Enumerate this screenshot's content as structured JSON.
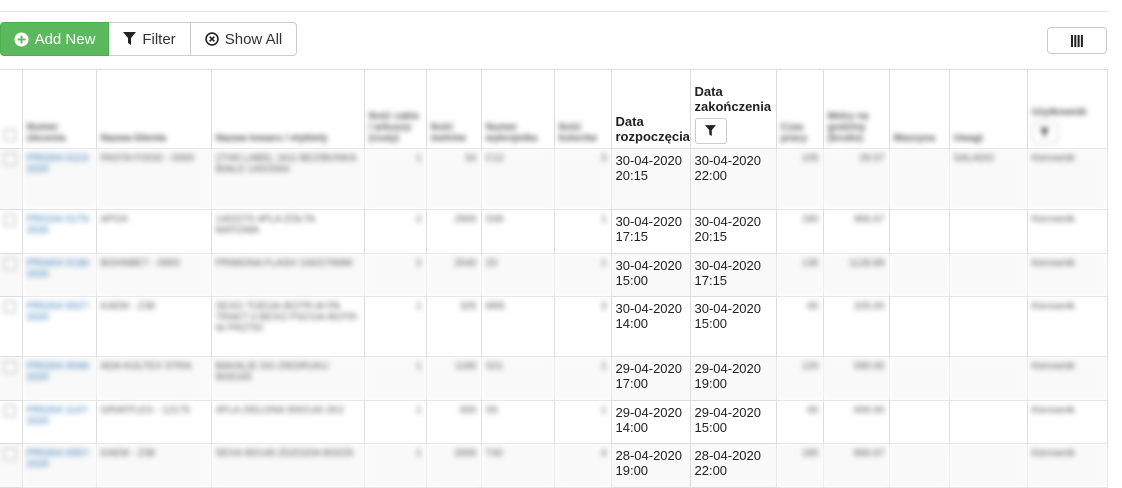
{
  "toolbar": {
    "add_label": "Add New",
    "filter_label": "Filter",
    "show_all_label": "Show All"
  },
  "colors": {
    "add_green": "#5cb85c",
    "link_blue": "#337ab7",
    "border": "#dddddd"
  },
  "table": {
    "headers": [
      "",
      "Numer zlecenia",
      "Nazwa klienta",
      "Nazwa towaru / etykiety",
      "Ilość cakie / arkuszy (rzuty)",
      "Ilość metrów",
      "Numer wykrojnika",
      "Ilość kolorów",
      "Data rozpoczęcia",
      "Data zakończenia",
      "Czas pracy",
      "Metry na godzinę (brutto)",
      "Maszyna",
      "Uwagi",
      "Użytkownik"
    ],
    "rows": [
      {
        "order": "PR0204 0113-2020",
        "client": "PASTA FOOD - 0000",
        "product": "27/40 LABEL 1KG BEZ/BUNKA BIAŁO 140/2064",
        "qty": "1",
        "meters": "54",
        "die": "C12",
        "colors": "3",
        "start": "30-04-2020 20:15",
        "end": "30-04-2020 22:00",
        "time": "105",
        "mph": "29.57",
        "machine": "",
        "notes": "SALADO",
        "user": "Kierownik"
      },
      {
        "order": "PR0104 0179-2020",
        "client": "APOX",
        "product": "140/2/70 4PLA ŻÓŁTA MATOWA",
        "qty": "2",
        "meters": "2900",
        "die": "S48",
        "colors": "1",
        "start": "30-04-2020 17:15",
        "end": "30-04-2020 20:15",
        "time": "180",
        "mph": "966.67",
        "machine": "",
        "notes": "",
        "user": "Kierownik"
      },
      {
        "order": "PR0404 0138-2020",
        "client": "BOHNBET - 0900",
        "product": "PRIMONA FLASH 100/270MM",
        "qty": "2",
        "meters": "2540",
        "die": "Z5",
        "colors": "1",
        "start": "30-04-2020 15:00",
        "end": "30-04-2020 17:15",
        "time": "135",
        "mph": "1128.89",
        "machine": "",
        "notes": "",
        "user": "Kierownik"
      },
      {
        "order": "PR0204 0027-2020",
        "client": "KAEM - Z38",
        "product": "SEXO TOEOA-BOTR-W-PA TRAKT-3 BEXO PSCOA-BOTR-W PRZTEI",
        "qty": "1",
        "meters": "325",
        "die": "M65",
        "colors": "3",
        "start": "30-04-2020 14:00",
        "end": "30-04-2020 15:00",
        "time": "60",
        "mph": "325.00",
        "machine": "",
        "notes": "",
        "user": "Kierownik"
      },
      {
        "order": "PR0204 0049-2020",
        "client": "ADA KOLTEX STRA",
        "product": "BAKALIE DO ZIEDRUKU 803/165",
        "qty": "1",
        "meters": "1180",
        "die": "S21",
        "colors": "1",
        "start": "29-04-2020 17:00",
        "end": "29-04-2020 19:00",
        "time": "120",
        "mph": "590.00",
        "machine": "",
        "notes": "",
        "user": "Kierownik"
      },
      {
        "order": "PR0204 1147-2020",
        "client": "GRAFFLEX - 12175",
        "product": "4PLA ZIELONA 500/140 2K2",
        "qty": "1",
        "meters": "600",
        "die": "S6",
        "colors": "1",
        "start": "29-04-2020 14:00",
        "end": "29-04-2020 15:00",
        "time": "60",
        "mph": "600.00",
        "machine": "",
        "notes": "",
        "user": "Kierownik"
      },
      {
        "order": "PR0204 0057-2020",
        "client": "KAEM - Z38",
        "product": "SEXA 90/149 ZDZOZIA 803/25",
        "qty": "1",
        "meters": "2600",
        "die": "T40",
        "colors": "4",
        "start": "28-04-2020 19:00",
        "end": "28-04-2020 22:00",
        "time": "180",
        "mph": "866.67",
        "machine": "",
        "notes": "",
        "user": "Kierownik"
      }
    ]
  }
}
